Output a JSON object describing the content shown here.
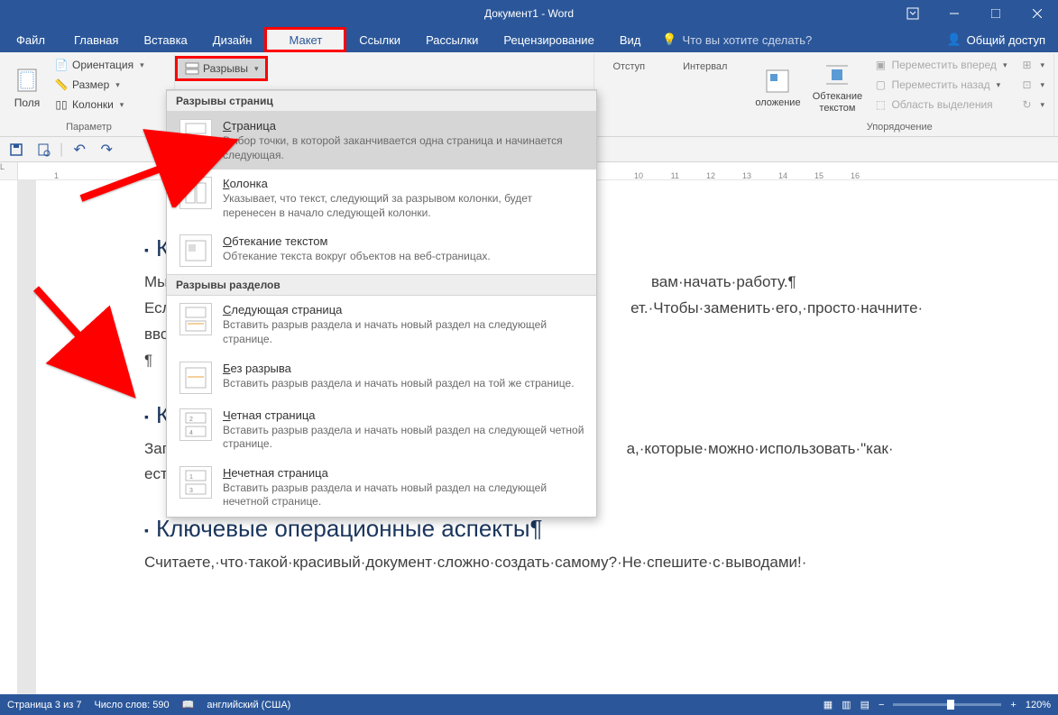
{
  "window": {
    "title": "Документ1 - Word"
  },
  "tabs": {
    "file": "Файл",
    "home": "Главная",
    "insert": "Вставка",
    "design": "Дизайн",
    "layout": "Макет",
    "references": "Ссылки",
    "mailings": "Рассылки",
    "review": "Рецензирование",
    "view": "Вид",
    "tellme": "Что вы хотите сделать?",
    "share": "Общий доступ"
  },
  "ribbon": {
    "margins": "Поля",
    "orientation": "Ориентация",
    "size": "Размер",
    "columns": "Колонки",
    "breaks": "Разрывы",
    "pagesetup_label": "Параметр",
    "indent": "Отступ",
    "spacing": "Интервал",
    "position": "оложение",
    "wrap": "Обтекание текстом",
    "bring_forward": "Переместить вперед",
    "send_backward": "Переместить назад",
    "selection_pane": "Область выделения",
    "arrange_label": "Упорядочение"
  },
  "dropdown": {
    "section1": "Разрывы страниц",
    "page_title": "Страница",
    "page_desc": "Выбор точки, в которой заканчивается одна страница и начинается следующая.",
    "column_title": "Колонка",
    "column_desc": "Указывает, что текст, следующий за разрывом колонки, будет перенесен в начало следующей колонки.",
    "textwrap_title": "Обтекание текстом",
    "textwrap_desc": "Обтекание текста вокруг объектов на веб-страницах.",
    "section2": "Разрывы разделов",
    "nextpage_title": "Следующая страница",
    "nextpage_desc": "Вставить разрыв раздела и начать новый раздел на следующей странице.",
    "continuous_title": "Без разрыва",
    "continuous_desc": "Вставить разрыв раздела и начать новый раздел на той же странице.",
    "evenpage_title": "Четная страница",
    "evenpage_desc": "Вставить разрыв раздела и начать новый раздел на следующей четной странице.",
    "oddpage_title": "Нечетная страница",
    "oddpage_desc": "Вставить разрыв раздела и начать новый раздел на следующей нечетной странице."
  },
  "document": {
    "h1": "Клю",
    "p1a": "Мы·д",
    "p1b": "вам·начать·работу.¶",
    "p2a": "Если",
    "p2b": "ет.·Чтобы·заменить·его,·просто·начните·",
    "p3": "ввод",
    "p4": "¶",
    "h2": "Клю",
    "p5a": "Загол",
    "p5b": "а,·которые·можно·использовать·\"как·",
    "p6": "есть\"",
    "h3": "Ключевые операционные аспекты¶",
    "p7": "Считаете,·что·такой·красивый·документ·сложно·создать·самому?·Не·спешите·с·выводами!·"
  },
  "status": {
    "page": "Страница 3 из 7",
    "words": "Число слов: 590",
    "lang": "английский (США)",
    "zoom": "120%"
  }
}
